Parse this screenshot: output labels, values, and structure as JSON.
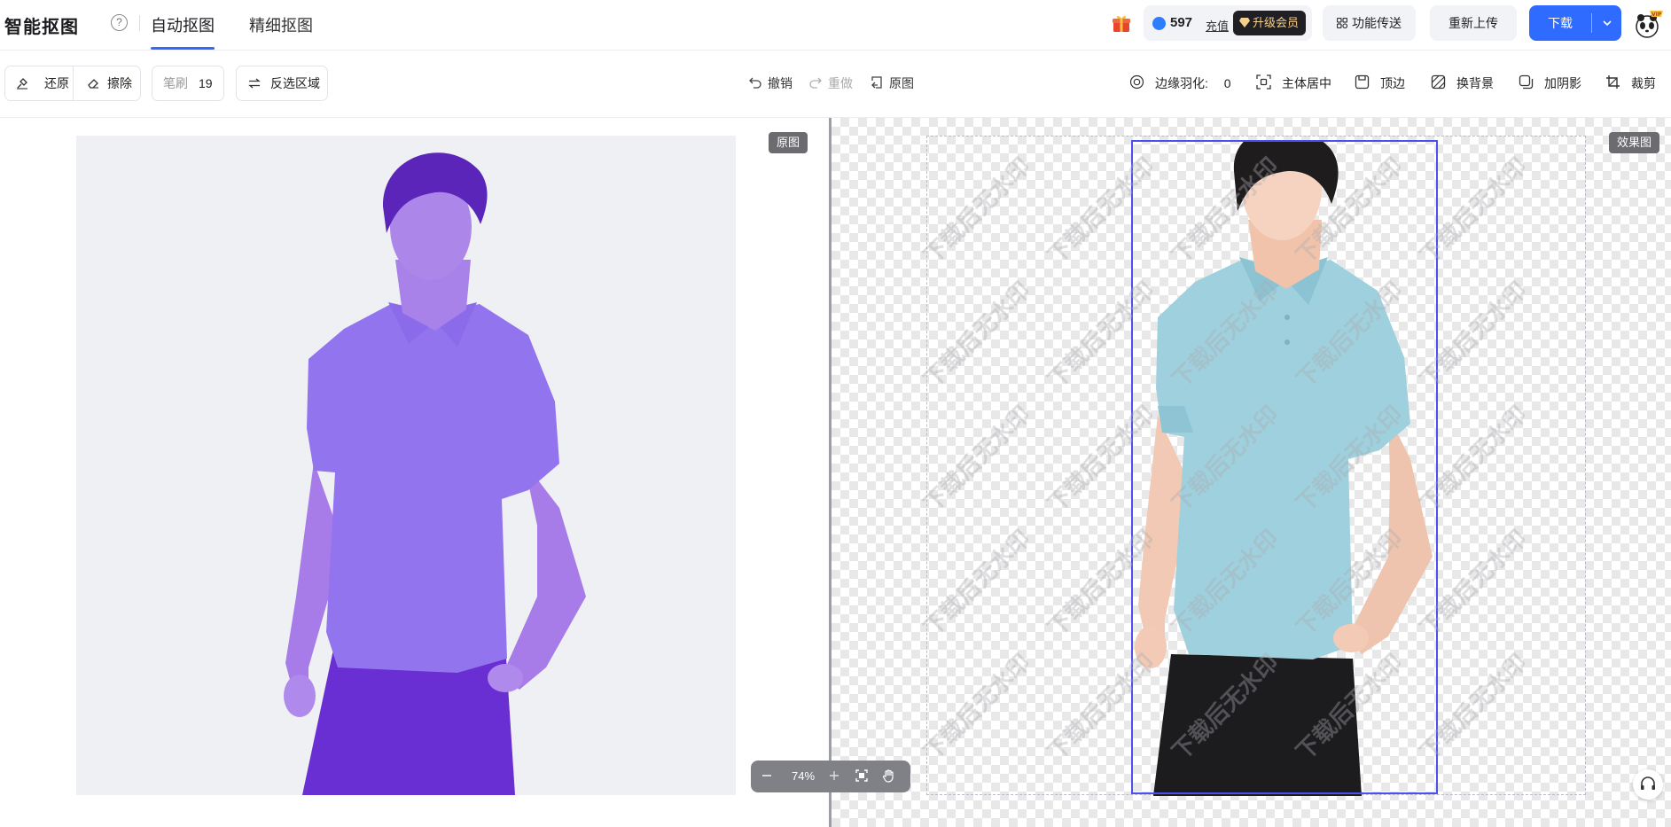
{
  "header": {
    "logo": "智能抠图",
    "help_symbol": "?",
    "tabs": [
      {
        "label": "自动抠图",
        "active": true
      },
      {
        "label": "精细抠图",
        "active": false
      }
    ],
    "coins": "597",
    "recharge_label": "充值",
    "vip_label": "升级会员",
    "forward_label": "功能传送",
    "reupload_label": "重新上传",
    "download_label": "下载",
    "avatar_badge": "VIP"
  },
  "toolbar": {
    "restore_label": "还原",
    "erase_label": "擦除",
    "brush_label": "笔刷",
    "brush_size": "19",
    "invert_label": "反选区域",
    "undo_label": "撤销",
    "redo_label": "重做",
    "original_label": "原图",
    "feather_label": "边缘羽化:",
    "feather_value": "0",
    "center_label": "主体居中",
    "top_label": "顶边",
    "bg_label": "换背景",
    "shadow_label": "加阴影",
    "crop_label": "裁剪"
  },
  "canvas": {
    "original_tag": "原图",
    "result_tag": "效果图",
    "watermark_text": "下载后无水印",
    "zoom_percent": "74%"
  },
  "colors": {
    "accent": "#2f6bff",
    "selection": "#4b50ee",
    "mask_purple": "#8f6cf2",
    "shirt_blue": "#9fd0de"
  }
}
